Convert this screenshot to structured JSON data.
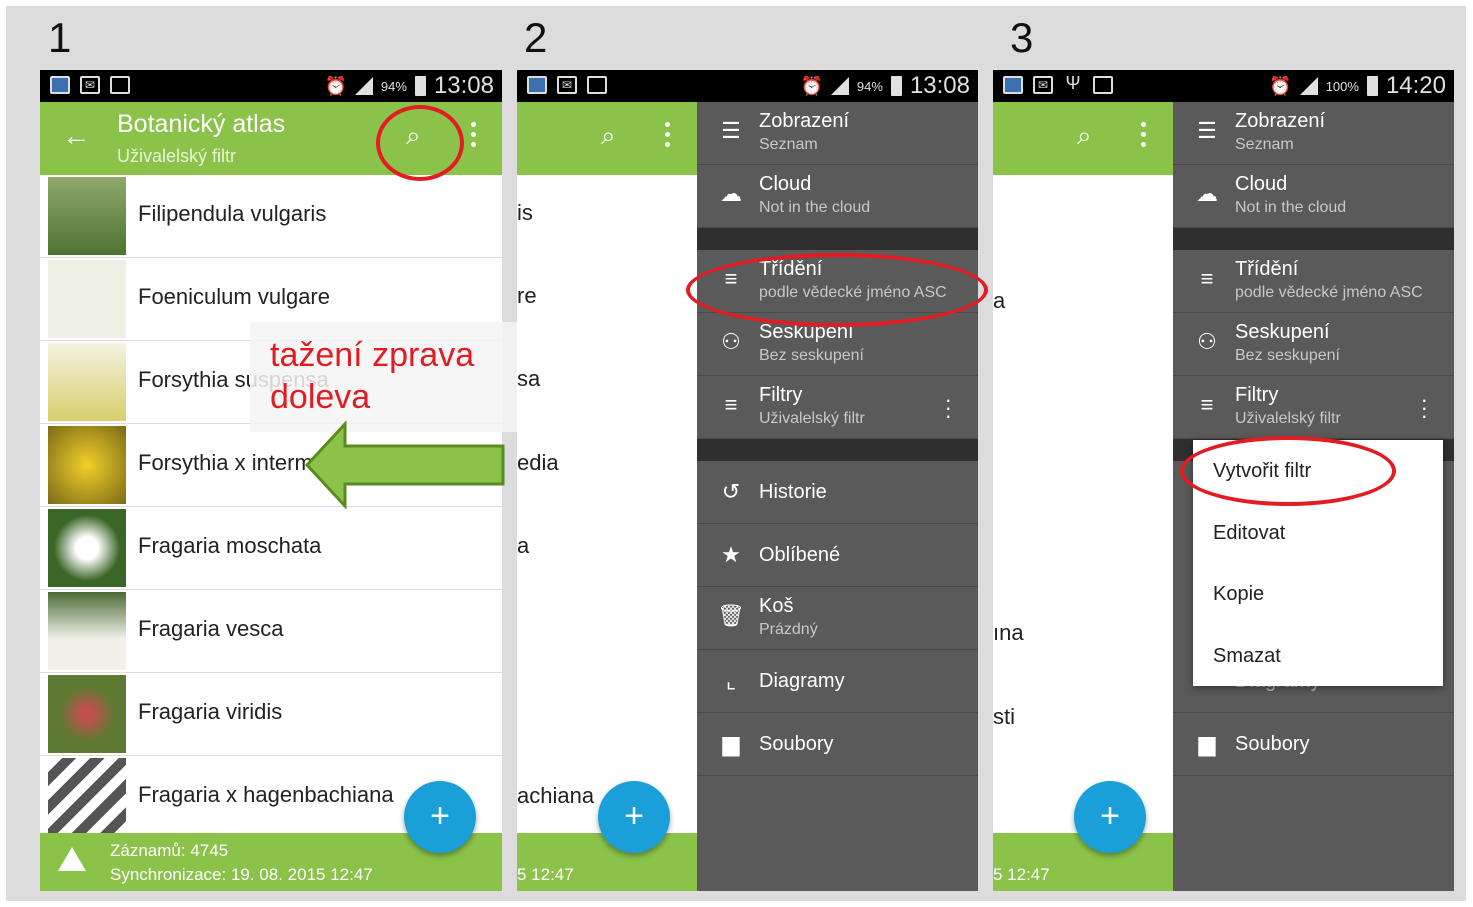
{
  "panel_numbers": [
    "1",
    "2",
    "3"
  ],
  "status": {
    "p1": {
      "battery": "94%",
      "time": "13:08"
    },
    "p2": {
      "battery": "94%",
      "time": "13:08"
    },
    "p3": {
      "battery": "100%",
      "time": "14:20"
    }
  },
  "toolbar": {
    "title": "Botanický atlas",
    "subtitle": "Uživalelský filtr"
  },
  "list": [
    {
      "name": "Filipendula vulgaris",
      "thumb_color": "#6b8a3c"
    },
    {
      "name": "Foeniculum vulgare",
      "thumb_color": "#d9dcc4"
    },
    {
      "name": "Forsythia suspensa",
      "thumb_color": "#e6e2b0"
    },
    {
      "name": "Forsythia x intermedia",
      "thumb_color": "#c9a414"
    },
    {
      "name": "Fragaria moschata",
      "thumb_color": "#3f6b2a"
    },
    {
      "name": "Fragaria vesca",
      "thumb_color": "#e3e6d8"
    },
    {
      "name": "Fragaria viridis",
      "thumb_color": "#5e7a33"
    },
    {
      "name": "Fragaria x hagenbachiana",
      "thumb_color": "#ffffff"
    }
  ],
  "footer": {
    "records": "Záznamů: 4745",
    "sync": "Synchronizace: 19. 08. 2015 12:47",
    "sync_short": "5 12:47"
  },
  "fab": {
    "label": "+"
  },
  "callout": {
    "line1": "tažení zprava",
    "line2": "doleva"
  },
  "peek2": [
    "is",
    "re",
    "sa",
    "edia",
    "a",
    "achiana"
  ],
  "peek3": [
    "a",
    "ına",
    "sti"
  ],
  "drawer": {
    "view": {
      "label": "Zobrazení",
      "sub": "Seznam"
    },
    "cloud": {
      "label": "Cloud",
      "sub": "Not in the cloud"
    },
    "sort": {
      "label": "Třídění",
      "sub": "podle vědecké jméno ASC"
    },
    "group": {
      "label": "Seskupení",
      "sub": "Bez seskupení"
    },
    "filter": {
      "label": "Filtry",
      "sub": "Uživalelský filtr"
    },
    "history": {
      "label": "Historie"
    },
    "favorites": {
      "label": "Oblíbené"
    },
    "trash": {
      "label": "Koš",
      "sub": "Prázdný"
    },
    "charts": {
      "label": "Diagramy"
    },
    "files": {
      "label": "Soubory"
    }
  },
  "popup": {
    "items": [
      "Vytvořit filtr",
      "Editovat",
      "Kopie",
      "Smazat"
    ],
    "hidden_behind": "Diagramy"
  },
  "colors": {
    "toolbar": "#8bc34a",
    "fab": "#1a9fd8",
    "drawer": "#5a5a5a",
    "highlight": "#e31b23"
  }
}
